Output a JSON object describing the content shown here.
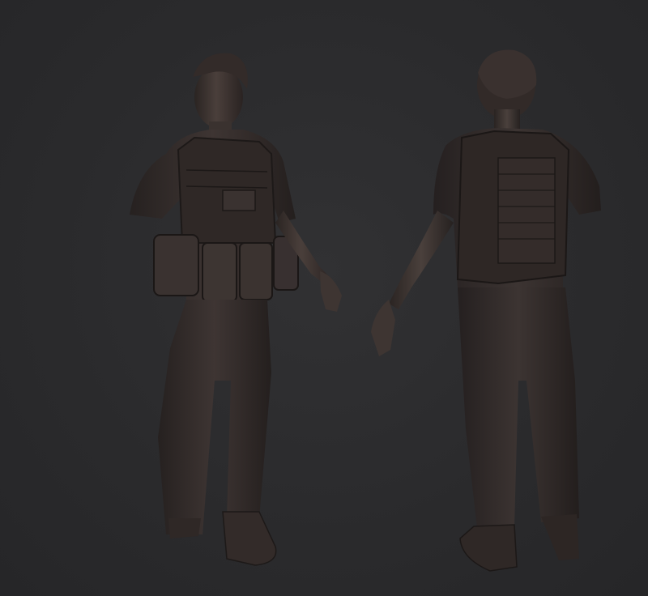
{
  "scene": {
    "background_color": "#2b2b2d",
    "material_color": "#3b3432",
    "highlight_color": "#6a5d58",
    "shadow_color": "#1e1a19",
    "views": [
      {
        "id": "front",
        "description_icon": "sculpt-figure-front-icon"
      },
      {
        "id": "back",
        "description_icon": "sculpt-figure-back-icon"
      }
    ]
  }
}
